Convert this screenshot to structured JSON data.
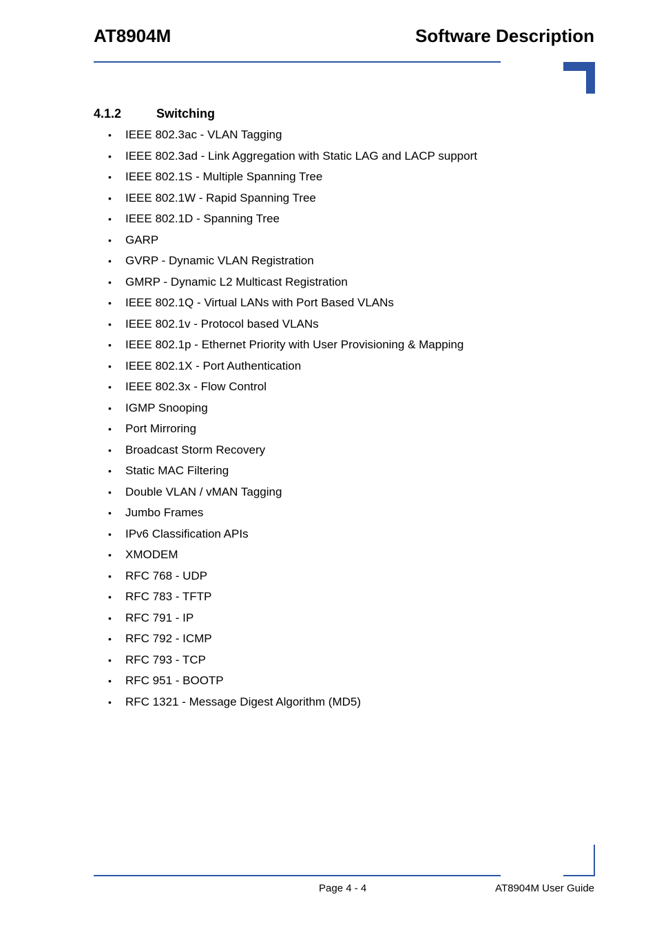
{
  "header": {
    "product": "AT8904M",
    "chapter": "Software Description"
  },
  "section": {
    "number": "4.1.2",
    "title": "Switching"
  },
  "features": [
    "IEEE 802.3ac - VLAN Tagging",
    "IEEE 802.3ad - Link Aggregation with Static LAG and LACP support",
    "IEEE 802.1S - Multiple Spanning Tree",
    "IEEE 802.1W - Rapid Spanning Tree",
    "IEEE 802.1D - Spanning Tree",
    "GARP",
    "GVRP - Dynamic VLAN Registration",
    "GMRP - Dynamic L2 Multicast Registration",
    "IEEE 802.1Q - Virtual LANs with Port Based VLANs",
    "IEEE 802.1v - Protocol based VLANs",
    "IEEE 802.1p - Ethernet Priority with User Provisioning & Mapping",
    "IEEE 802.1X - Port Authentication",
    "IEEE 802.3x - Flow Control",
    "IGMP Snooping",
    "Port Mirroring",
    "Broadcast Storm Recovery",
    "Static MAC Filtering",
    "Double VLAN / vMAN Tagging",
    "Jumbo Frames",
    "IPv6 Classification APIs",
    "XMODEM",
    "RFC 768 - UDP",
    "RFC 783 - TFTP",
    "RFC 791 - IP",
    "RFC 792 - ICMP",
    "RFC 793 - TCP",
    "RFC 951 - BOOTP",
    "RFC 1321 - Message Digest Algorithm (MD5)"
  ],
  "bullet_char": "•",
  "footer": {
    "page": "Page 4 - 4",
    "guide": "AT8904M User Guide"
  },
  "colors": {
    "accent": "#2E55A4",
    "text": "#000000",
    "background": "#FFFFFF"
  }
}
